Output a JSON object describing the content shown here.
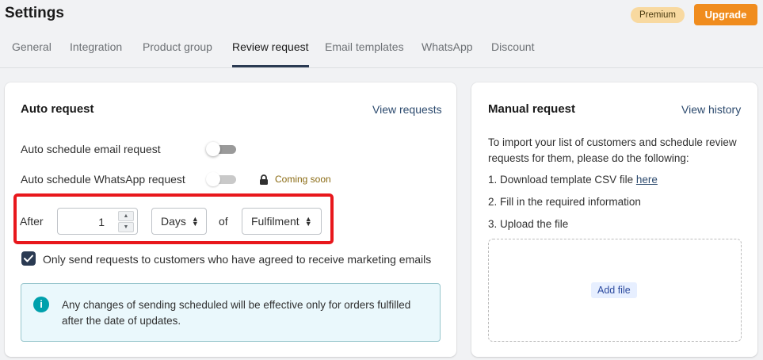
{
  "header": {
    "title": "Settings",
    "badge": "Premium",
    "upgrade_label": "Upgrade"
  },
  "tabs": [
    {
      "label": "General"
    },
    {
      "label": "Integration"
    },
    {
      "label": "Product group"
    },
    {
      "label": "Review request",
      "active": true
    },
    {
      "label": "Email templates"
    },
    {
      "label": "WhatsApp"
    },
    {
      "label": "Discount"
    }
  ],
  "auto_request": {
    "title": "Auto request",
    "view_link": "View requests",
    "email_toggle_label": "Auto schedule email request",
    "email_toggle_on": false,
    "whatsapp_toggle_label": "Auto schedule WhatsApp request",
    "whatsapp_toggle_on": false,
    "coming_soon": "Coming soon",
    "after_label": "After",
    "after_value": "1",
    "unit_selected": "Days",
    "of_label": "of",
    "event_selected": "Fulfilment",
    "consent_checked": true,
    "consent_label": "Only send requests to customers who have agreed to receive marketing emails",
    "info_text": "Any changes of sending scheduled will be effective only for orders fulfilled after the date of updates."
  },
  "manual_request": {
    "title": "Manual request",
    "view_link": "View history",
    "intro": "To import your list of customers and schedule review requests for them, please do the following:",
    "step1_prefix": "1. Download template CSV file ",
    "step1_link": "here",
    "step2": "2. Fill in the required information",
    "step3": "3. Upload the file",
    "add_file_label": "Add file"
  },
  "colors": {
    "accent": "#2a3a52",
    "upgrade": "#f08c1d",
    "highlight": "#e8171c",
    "info": "#00a0ac"
  }
}
